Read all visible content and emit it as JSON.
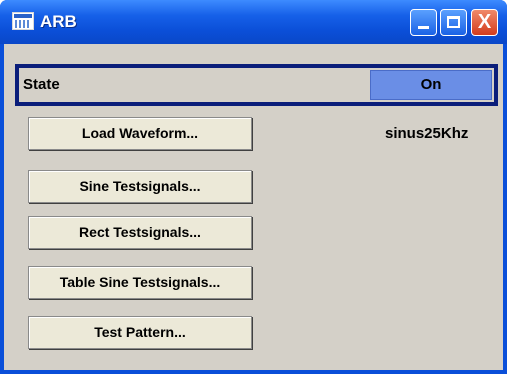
{
  "window": {
    "title": "ARB",
    "controls": {
      "minimize": "",
      "maximize": "",
      "close": "X"
    }
  },
  "state": {
    "label": "State",
    "value": "On"
  },
  "buttons": {
    "load_waveform": "Load Waveform...",
    "sine_testsignals": "Sine Testsignals...",
    "rect_testsignals": "Rect Testsignals...",
    "table_sine_testsignals": "Table Sine Testsignals...",
    "test_pattern": "Test Pattern..."
  },
  "waveform_name": "sinus25Khz",
  "icons": [
    "arb-app-icon",
    "minimize-icon",
    "maximize-icon",
    "close-icon"
  ],
  "colors": {
    "titlebar": "#0b4fd8",
    "client_bg": "#d4d0c8",
    "state_border": "#0a1d7a",
    "state_value_bg": "#6a8ee6",
    "close_button": "#d33c1d"
  }
}
